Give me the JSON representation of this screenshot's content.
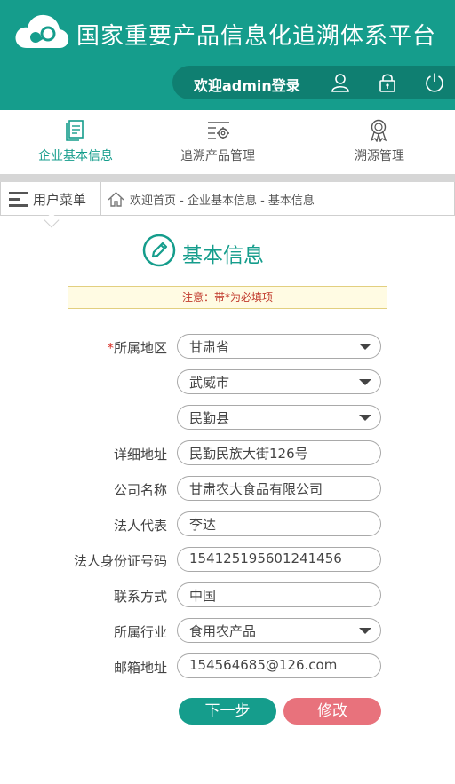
{
  "header": {
    "title": "国家重要产品信息化追溯体系平台",
    "welcome": "欢迎admin登录",
    "icons": [
      "user-icon",
      "lock-icon",
      "power-icon"
    ]
  },
  "nav": {
    "items": [
      {
        "label": "企业基本信息",
        "icon": "document-icon",
        "active": true
      },
      {
        "label": "追溯产品管理",
        "icon": "settings-list-icon",
        "active": false
      },
      {
        "label": "溯源管理",
        "icon": "award-icon",
        "active": false
      }
    ]
  },
  "menu": {
    "label": "用户菜单"
  },
  "breadcrumb": {
    "text": "欢迎首页 - 企业基本信息 - 基本信息"
  },
  "section": {
    "title": "基本信息"
  },
  "notice": {
    "text": "注意：带*为必填项"
  },
  "form": {
    "region_label": "所属地区",
    "region_required_mark": "*",
    "province": "甘肃省",
    "city": "武威市",
    "county": "民勤县",
    "address_label": "详细地址",
    "address": "民勤民族大街126号",
    "company_label": "公司名称",
    "company": "甘肃农大食品有限公司",
    "legal_label": "法人代表",
    "legal": "李达",
    "idcard_label": "法人身份证号码",
    "idcard": "154125195601241456",
    "contact_label": "联系方式",
    "contact": "中国",
    "industry_label": "所属行业",
    "industry": "食用农产品",
    "email_label": "邮箱地址",
    "email": "154564685@126.com"
  },
  "buttons": {
    "next": "下一步",
    "edit": "修改"
  },
  "colors": {
    "primary": "#159d8c",
    "primary_dark": "#0f7f71",
    "danger": "#e8727c",
    "notice_bg": "#fffbe3",
    "notice_text": "#c0392b"
  }
}
